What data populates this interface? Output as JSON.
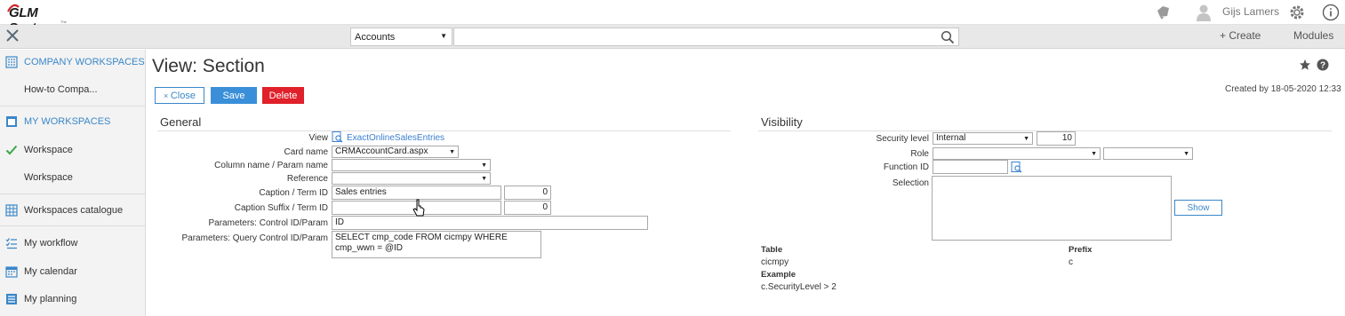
{
  "app": {
    "logo_text": "GLM Systems",
    "logo_subtext": "The Leading Co."
  },
  "topbar": {
    "user_name": "Gijs Lamers",
    "icons": [
      "notification-icon",
      "user-avatar-icon",
      "gear-icon",
      "info-icon"
    ]
  },
  "menubar": {
    "entity_select_value": "Accounts",
    "search_placeholder": "",
    "create_label": "+ Create",
    "modules_label": "Modules"
  },
  "sidebar": {
    "items": [
      {
        "label": "COMPANY WORKSPACES",
        "icon": "building-icon",
        "section": true
      },
      {
        "label": "How-to Compa...",
        "icon": "",
        "section": false
      },
      {
        "label": "MY WORKSPACES",
        "icon": "workspace-icon",
        "section": true
      },
      {
        "label": "Workspace",
        "icon": "checkmark-icon",
        "section": false
      },
      {
        "label": "Workspace",
        "icon": "",
        "section": false
      },
      {
        "label": "Workspaces catalogue",
        "icon": "grid-icon",
        "section": false
      },
      {
        "label": "My workflow",
        "icon": "list-icon",
        "section": false
      },
      {
        "label": "My calendar",
        "icon": "calendar-icon",
        "section": false
      },
      {
        "label": "My planning",
        "icon": "planning-icon",
        "section": false
      }
    ]
  },
  "page": {
    "title": "View: Section",
    "close_label": "Close",
    "save_label": "Save",
    "delete_label": "Delete",
    "created_by": "Created by 18-05-2020 12:33"
  },
  "general": {
    "title": "General",
    "view_label": "View",
    "view_value": "ExactOnlineSalesEntries",
    "card_name_label": "Card name",
    "card_name_value": "CRMAccountCard.aspx",
    "column_name_label": "Column name / Param name",
    "column_name_value": "",
    "reference_label": "Reference",
    "reference_value": "",
    "caption_label": "Caption / Term ID",
    "caption_value": "Sales entries",
    "caption_term_id": "0",
    "caption_suffix_label": "Caption Suffix / Term ID",
    "caption_suffix_value": "",
    "caption_suffix_term_id": "0",
    "params_control_label": "Parameters: Control ID/Param",
    "params_control_value": "ID",
    "params_query_label": "Parameters: Query Control ID/Param",
    "params_query_line1": "SELECT cmp_code FROM cicmpy WHERE",
    "params_query_line2": "cmp_wwn = @ID"
  },
  "visibility": {
    "title": "Visibility",
    "security_level_label": "Security level",
    "security_level_value": "Internal",
    "security_level_number": "10",
    "role_label": "Role",
    "role_value": "",
    "role_value2": "",
    "function_id_label": "Function ID",
    "function_id_value": "",
    "selection_label": "Selection",
    "selection_value": "",
    "show_label": "Show",
    "table_label": "Table",
    "table_value": "cicmpy",
    "prefix_label": "Prefix",
    "prefix_value": "c",
    "example_label": "Example",
    "example_value": "c.SecurityLevel > 2"
  }
}
